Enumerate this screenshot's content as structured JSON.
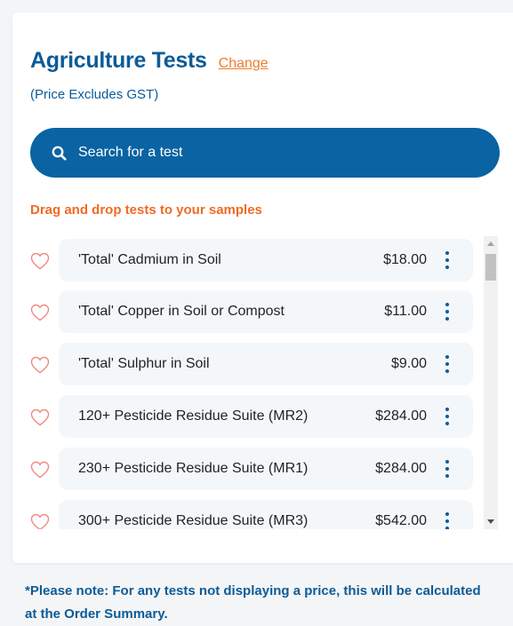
{
  "header": {
    "title": "Agriculture Tests",
    "change_label": "Change",
    "price_note": "(Price Excludes GST)"
  },
  "search": {
    "placeholder": "Search for a test",
    "icon": "search-icon"
  },
  "drag_hint": "Drag and drop tests to your samples",
  "tests": [
    {
      "name": "'Total' Cadmium in Soil",
      "price": "$18.00"
    },
    {
      "name": "'Total' Copper in Soil or Compost",
      "price": "$11.00"
    },
    {
      "name": "'Total' Sulphur in Soil",
      "price": "$9.00"
    },
    {
      "name": "120+ Pesticide Residue Suite (MR2)",
      "price": "$284.00"
    },
    {
      "name": "230+ Pesticide Residue Suite (MR1)",
      "price": "$284.00"
    },
    {
      "name": "300+ Pesticide Residue Suite (MR3)",
      "price": "$542.00"
    }
  ],
  "footer_note": "*Please note: For any tests not displaying a price, this will be calculated at the Order Summary.",
  "colors": {
    "brand_blue": "#0d5b97",
    "search_bg": "#0a63a2",
    "accent_orange": "#ef6a24",
    "heart": "#f08a80",
    "row_bg": "#f4f7fa"
  }
}
